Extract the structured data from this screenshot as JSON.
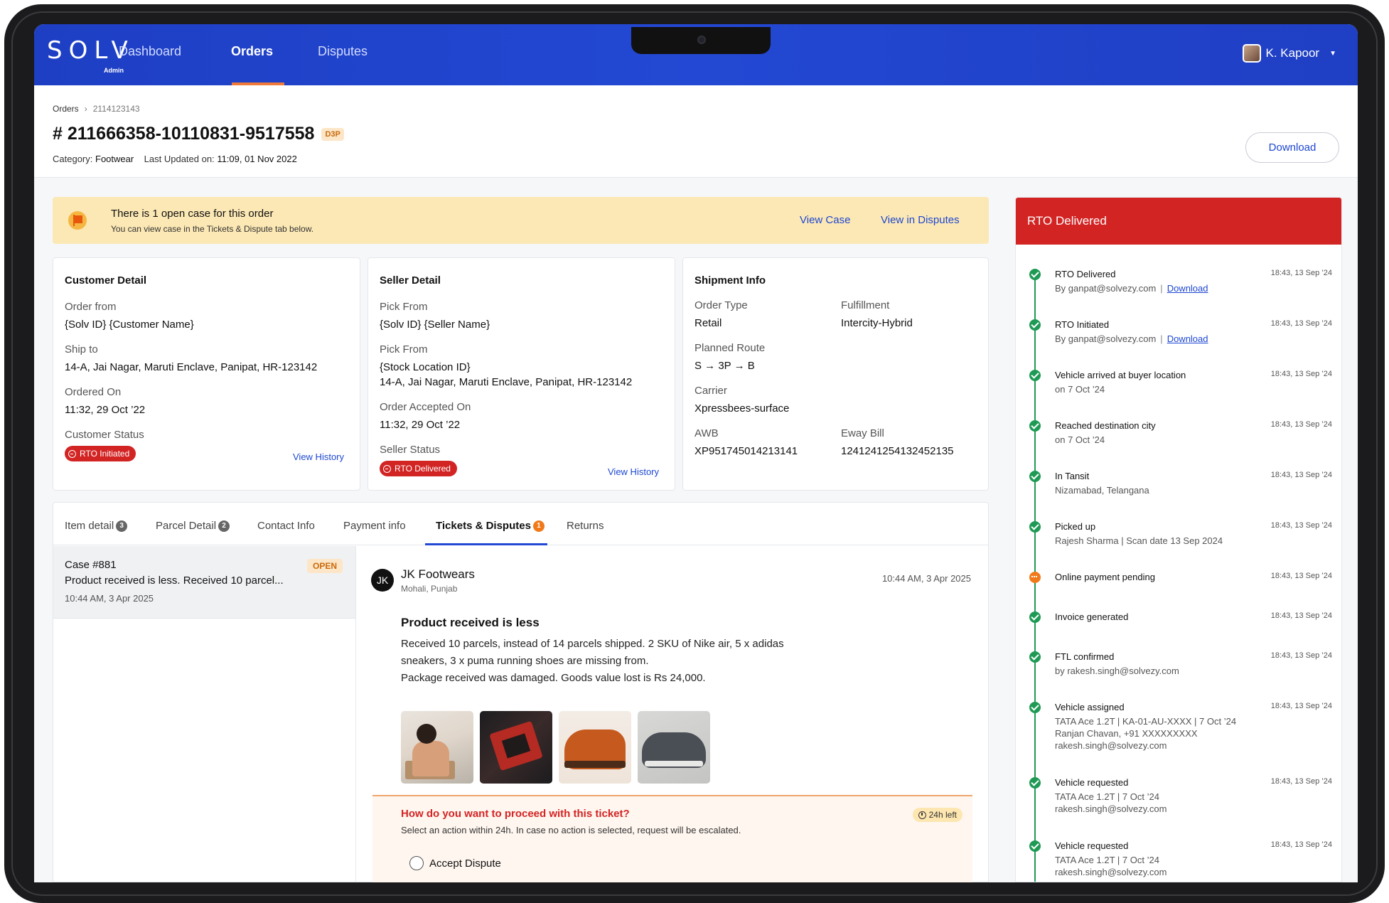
{
  "app": {
    "logo": "SOLV",
    "logo_sub": "Admin"
  },
  "nav": {
    "items": [
      {
        "label": "Dashboard"
      },
      {
        "label": "Orders"
      },
      {
        "label": "Disputes"
      }
    ],
    "user": "K. Kapoor"
  },
  "breadcrumb": {
    "root": "Orders",
    "current": "2114123143"
  },
  "order": {
    "title": "# 211666358-10110831-9517558",
    "tag": "D3P",
    "category_label": "Category:",
    "category": "Footwear",
    "updated_label": "Last Updated on:",
    "updated": "11:09, 01 Nov 2022",
    "download": "Download"
  },
  "alert": {
    "title": "There is 1 open case for this order",
    "subtitle": "You can view case in the Tickets & Dispute tab below.",
    "view_case": "View Case",
    "view_disputes": "View in Disputes"
  },
  "customer": {
    "title": "Customer Detail",
    "order_from_label": "Order from",
    "order_from": "{Solv ID} {Customer Name}",
    "ship_to_label": "Ship to",
    "ship_to": "14-A, Jai Nagar, Maruti Enclave, Panipat, HR-123142",
    "ordered_on_label": "Ordered On",
    "ordered_on": "11:32, 29 Oct ’22",
    "status_label": "Customer Status",
    "status": "RTO Initiated",
    "history": "View History"
  },
  "seller": {
    "title": "Seller Detail",
    "pick_from_label": "Pick From",
    "pick_from": "{Solv ID} {Seller Name}",
    "pick_from2_label": "Pick From",
    "location_id": "{Stock Location ID}",
    "location_addr": "14-A, Jai Nagar, Maruti Enclave, Panipat, HR-123142",
    "accepted_label": "Order Accepted On",
    "accepted": "11:32, 29 Oct ’22",
    "status_label": "Seller Status",
    "status": "RTO Delivered",
    "history": "View History"
  },
  "shipment": {
    "title": "Shipment Info",
    "order_type_label": "Order Type",
    "order_type": "Retail",
    "fulfillment_label": "Fulfillment",
    "fulfillment": "Intercity-Hybrid",
    "route_label": "Planned Route",
    "route": "S → 3P →  B",
    "carrier_label": "Carrier",
    "carrier": "Xpressbees-surface",
    "awb_label": "AWB",
    "awb": "XP951745014213141",
    "eway_label": "Eway Bill",
    "eway": "1241241254132452135"
  },
  "tabs": [
    {
      "label": "Item detail",
      "badge": "3"
    },
    {
      "label": "Parcel Detail",
      "badge": "2"
    },
    {
      "label": "Contact Info",
      "badge": ""
    },
    {
      "label": "Payment info",
      "badge": ""
    },
    {
      "label": "Tickets & Disputes",
      "badge": "1"
    },
    {
      "label": "Returns",
      "badge": ""
    }
  ],
  "case": {
    "id": "Case #881",
    "status": "OPEN",
    "desc": "Product received is less. Received 10 parcel...",
    "time": "10:44 AM, 3 Apr 2025"
  },
  "ticket": {
    "initials": "JK",
    "seller": "JK Footwears",
    "location": "Mohali, Punjab",
    "time": "10:44 AM, 3 Apr 2025",
    "title": "Product received is less",
    "body1": "Received 10 parcels, instead of 14 parcels shipped. 2 SKU of Nike air, 5 x adidas sneakers, 3 x puma running shoes are missing from.",
    "body2": "Package received was damaged. Goods value lost is Rs 24,000.",
    "question": "How do you want to proceed with this ticket?",
    "instruction": "Select an action within 24h. In case no action is selected, request will be escalated.",
    "time_left": "24h left",
    "option1": "Accept Dispute"
  },
  "rto": {
    "header": "RTO Delivered",
    "events": [
      {
        "title": "RTO Delivered",
        "sub": "By ganpat@solvezy.com",
        "link": "Download",
        "time": "18:43, 13 Sep ’24",
        "state": "done"
      },
      {
        "title": "RTO Initiated",
        "sub": "By ganpat@solvezy.com",
        "link": "Download",
        "time": "18:43, 13 Sep ’24",
        "state": "done"
      },
      {
        "title": "Vehicle arrived at buyer location",
        "sub": "on 7 Oct ’24",
        "link": "",
        "time": "18:43, 13 Sep ’24",
        "state": "done"
      },
      {
        "title": "Reached destination city",
        "sub": "on 7 Oct ’24",
        "link": "",
        "time": "18:43, 13 Sep ’24",
        "state": "done"
      },
      {
        "title": "In Tansit",
        "sub": "Nizamabad, Telangana",
        "link": "",
        "time": "18:43, 13 Sep ’24",
        "state": "done"
      },
      {
        "title": "Picked up",
        "sub": "Rajesh Sharma | Scan date 13 Sep 2024",
        "link": "",
        "time": "18:43, 13 Sep ’24",
        "state": "done"
      },
      {
        "title": "Online payment pending",
        "sub": "",
        "link": "",
        "time": "18:43, 13 Sep ’24",
        "state": "pending"
      },
      {
        "title": "Invoice generated",
        "sub": "",
        "link": "",
        "time": "18:43, 13 Sep ’24",
        "state": "done"
      },
      {
        "title": "FTL confirmed",
        "sub": "by rakesh.singh@solvezy.com",
        "link": "",
        "time": "18:43, 13 Sep ’24",
        "state": "done"
      },
      {
        "title": "Vehicle assigned",
        "sub": "TATA Ace 1.2T | KA-01-AU-XXXX | 7 Oct ’24\nRanjan Chavan, +91 XXXXXXXXX\nrakesh.singh@solvezy.com",
        "link": "",
        "time": "18:43, 13 Sep ’24",
        "state": "done"
      },
      {
        "title": "Vehicle requested",
        "sub": "TATA Ace 1.2T | 7 Oct ’24\nrakesh.singh@solvezy.com",
        "link": "",
        "time": "18:43, 13 Sep ’24",
        "state": "done"
      },
      {
        "title": "Vehicle requested",
        "sub": "TATA Ace 1.2T | 7 Oct ’24\nrakesh.singh@solvezy.com",
        "link": "",
        "time": "18:43, 13 Sep ’24",
        "state": "done"
      }
    ]
  },
  "colors": {
    "nav_blue": "#2348d3",
    "accent_orange": "#f07a3a",
    "danger_red": "#d32424",
    "success_green": "#1f9a55",
    "alert_yellow": "#fce8b4"
  }
}
